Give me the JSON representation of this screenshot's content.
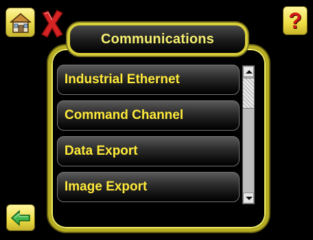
{
  "header": {
    "title": "Communications",
    "help_label": "?"
  },
  "menu": {
    "items": [
      {
        "label": "Industrial Ethernet"
      },
      {
        "label": "Command Channel"
      },
      {
        "label": "Data Export"
      },
      {
        "label": "Image Export"
      }
    ]
  },
  "icons": {
    "home": "home-icon",
    "cancel": "close-icon",
    "help": "help-icon",
    "back": "back-arrow-icon"
  },
  "colors": {
    "accent_yellow": "#ffea3a",
    "frame_yellow": "#b6ad22",
    "cancel_red": "#d62424",
    "back_green": "#3fb54b"
  }
}
